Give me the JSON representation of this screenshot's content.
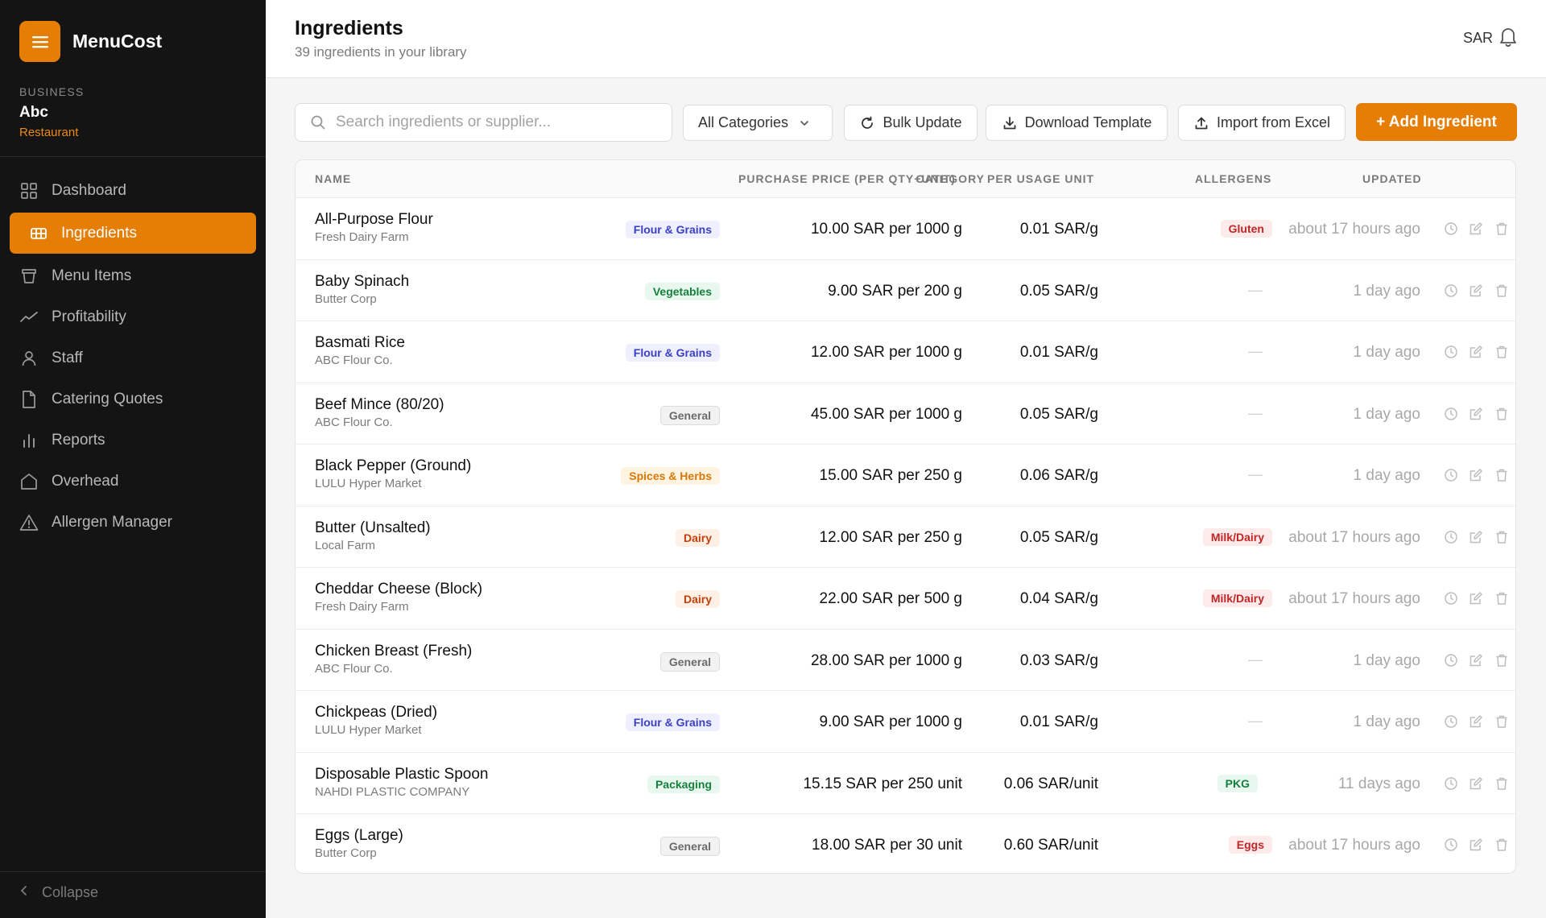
{
  "app": {
    "name": "MenuCost"
  },
  "business": {
    "label": "BUSINESS",
    "name": "Abc",
    "type": "Restaurant"
  },
  "nav": [
    {
      "label": "Dashboard",
      "icon": "grid-icon",
      "active": false
    },
    {
      "label": "Ingredients",
      "icon": "ingredients-icon",
      "active": true
    },
    {
      "label": "Menu Items",
      "icon": "cup-icon",
      "active": false
    },
    {
      "label": "Profitability",
      "icon": "trend-icon",
      "active": false
    },
    {
      "label": "Staff",
      "icon": "user-icon",
      "active": false
    },
    {
      "label": "Catering Quotes",
      "icon": "document-icon",
      "active": false
    },
    {
      "label": "Reports",
      "icon": "bar-chart-icon",
      "active": false
    },
    {
      "label": "Overhead",
      "icon": "house-icon",
      "active": false
    },
    {
      "label": "Allergen Manager",
      "icon": "warning-icon",
      "active": false
    }
  ],
  "collapse_label": "Collapse",
  "header": {
    "title": "Ingredients",
    "subtitle": "39 ingredients in your library",
    "currency": "SAR"
  },
  "toolbar": {
    "search_placeholder": "Search ingredients or supplier...",
    "category_filter": "All Categories",
    "bulk_update": "Bulk Update",
    "download_template": "Download Template",
    "import_excel": "Import from Excel",
    "add_ingredient": "+ Add Ingredient"
  },
  "columns": {
    "name": "NAME",
    "category": "CATEGORY",
    "purchase_price": "PURCHASE PRICE (PER QTY+UNIT)",
    "per_usage_unit": "PER USAGE UNIT",
    "allergens": "ALLERGENS",
    "updated": "UPDATED"
  },
  "colors": {
    "accent": "#e67e06",
    "flour_grains": {
      "bg": "#eef0ff",
      "fg": "#3b3fc4"
    },
    "vegetables": {
      "bg": "#e8f8ee",
      "fg": "#16803c"
    },
    "general": {
      "bg": "#f2f2f2",
      "fg": "#6b6b6b"
    },
    "spices_herbs": {
      "bg": "#fff3e2",
      "fg": "#d97706"
    },
    "dairy": {
      "bg": "#fff0e6",
      "fg": "#c2410c"
    },
    "packaging": {
      "bg": "#e8f8ee",
      "fg": "#16803c"
    },
    "allergen": {
      "bg": "#fdeaea",
      "fg": "#c02626"
    },
    "allergen_pkg": {
      "bg": "#e8f8ee",
      "fg": "#15803d"
    }
  },
  "rows": [
    {
      "name": "All-Purpose Flour",
      "supplier": "Fresh Dairy Farm",
      "category": "Flour & Grains",
      "cat_style": "flour_grains",
      "price": "10.00 SAR per 1000 g",
      "unit_price": "0.01 SAR/g",
      "allergen": "Gluten",
      "allergen_style": "allergen",
      "updated": "about 17 hours ago"
    },
    {
      "name": "Baby Spinach",
      "supplier": "Butter Corp",
      "category": "Vegetables",
      "cat_style": "vegetables",
      "price": "9.00 SAR per 200 g",
      "unit_price": "0.05 SAR/g",
      "allergen": "",
      "allergen_style": "",
      "updated": "1 day ago"
    },
    {
      "name": "Basmati Rice",
      "supplier": "ABC Flour Co.",
      "category": "Flour & Grains",
      "cat_style": "flour_grains",
      "price": "12.00 SAR per 1000 g",
      "unit_price": "0.01 SAR/g",
      "allergen": "",
      "allergen_style": "",
      "updated": "1 day ago"
    },
    {
      "name": "Beef Mince (80/20)",
      "supplier": "ABC Flour Co.",
      "category": "General",
      "cat_style": "general",
      "price": "45.00 SAR per 1000 g",
      "unit_price": "0.05 SAR/g",
      "allergen": "",
      "allergen_style": "",
      "updated": "1 day ago"
    },
    {
      "name": "Black Pepper (Ground)",
      "supplier": "LULU Hyper Market",
      "category": "Spices & Herbs",
      "cat_style": "spices_herbs",
      "price": "15.00 SAR per 250 g",
      "unit_price": "0.06 SAR/g",
      "allergen": "",
      "allergen_style": "",
      "updated": "1 day ago"
    },
    {
      "name": "Butter (Unsalted)",
      "supplier": "Local Farm",
      "category": "Dairy",
      "cat_style": "dairy",
      "price": "12.00 SAR per 250 g",
      "unit_price": "0.05 SAR/g",
      "allergen": "Milk/Dairy",
      "allergen_style": "allergen",
      "updated": "about 17 hours ago"
    },
    {
      "name": "Cheddar Cheese (Block)",
      "supplier": "Fresh Dairy Farm",
      "category": "Dairy",
      "cat_style": "dairy",
      "price": "22.00 SAR per 500 g",
      "unit_price": "0.04 SAR/g",
      "allergen": "Milk/Dairy",
      "allergen_style": "allergen",
      "updated": "about 17 hours ago"
    },
    {
      "name": "Chicken Breast (Fresh)",
      "supplier": "ABC Flour Co.",
      "category": "General",
      "cat_style": "general",
      "price": "28.00 SAR per 1000 g",
      "unit_price": "0.03 SAR/g",
      "allergen": "",
      "allergen_style": "",
      "updated": "1 day ago"
    },
    {
      "name": "Chickpeas (Dried)",
      "supplier": "LULU Hyper Market",
      "category": "Flour & Grains",
      "cat_style": "flour_grains",
      "price": "9.00 SAR per 1000 g",
      "unit_price": "0.01 SAR/g",
      "allergen": "",
      "allergen_style": "",
      "updated": "1 day ago"
    },
    {
      "name": "Disposable Plastic Spoon",
      "supplier": "NAHDI PLASTIC COMPANY",
      "category": "Packaging",
      "cat_style": "packaging",
      "price": "15.15 SAR per 250 unit",
      "unit_price": "0.06 SAR/unit",
      "allergen": "PKG",
      "allergen_style": "allergen_pkg",
      "updated": "11 days ago"
    },
    {
      "name": "Eggs (Large)",
      "supplier": "Butter Corp",
      "category": "General",
      "cat_style": "general",
      "price": "18.00 SAR per 30 unit",
      "unit_price": "0.60 SAR/unit",
      "allergen": "Eggs",
      "allergen_style": "allergen",
      "updated": "about 17 hours ago"
    }
  ],
  "empty_allergen": "—"
}
